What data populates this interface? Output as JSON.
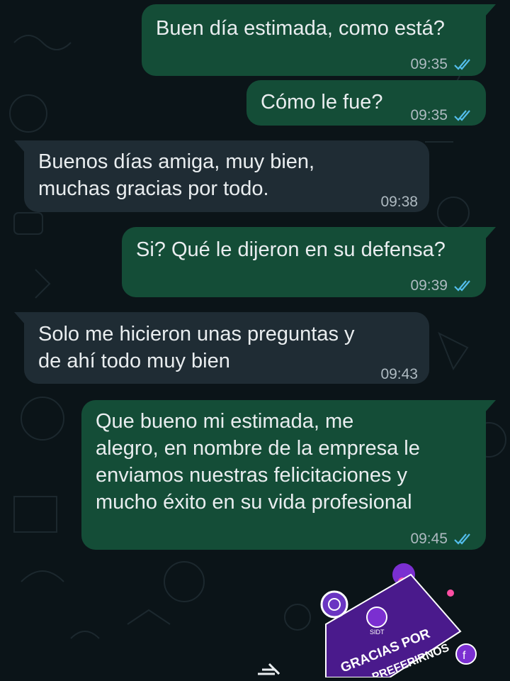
{
  "chat": {
    "messages": [
      {
        "direction": "outgoing",
        "text": "Buen día estimada, como está?",
        "time": "09:35",
        "status": "read"
      },
      {
        "direction": "outgoing",
        "text": "Cómo le fue?",
        "time": "09:35",
        "status": "read"
      },
      {
        "direction": "incoming",
        "lines": [
          "Buenos días amiga, muy bien,",
          "muchas gracias por todo."
        ],
        "time": "09:38"
      },
      {
        "direction": "outgoing",
        "text": "Si? Qué le dijeron en su defensa?",
        "time": "09:39",
        "status": "read"
      },
      {
        "direction": "incoming",
        "lines": [
          "Solo me hicieron unas preguntas y",
          "de ahí todo muy bien"
        ],
        "time": "09:43"
      },
      {
        "direction": "outgoing",
        "lines": [
          "Que bueno mi estimada, me",
          "alegro, en nombre de la empresa le",
          "enviamos nuestras felicitaciones y",
          "mucho éxito en su vida profesional"
        ],
        "time": "09:45",
        "status": "read"
      }
    ]
  },
  "promo": {
    "logo_text": "SIDT",
    "line1": "GRACIAS POR",
    "line2": "PREFERIRNOS"
  },
  "icons": {
    "read": "double-check-icon",
    "forward": "forward-icon"
  },
  "colors": {
    "background": "#0b1418",
    "outgoing_bubble": "#144d37",
    "incoming_bubble": "#1f2c34",
    "text": "#e9edef",
    "meta": "#aebac1",
    "read_ticks": "#53bdeb",
    "promo_purple": "#4a1a8c"
  }
}
